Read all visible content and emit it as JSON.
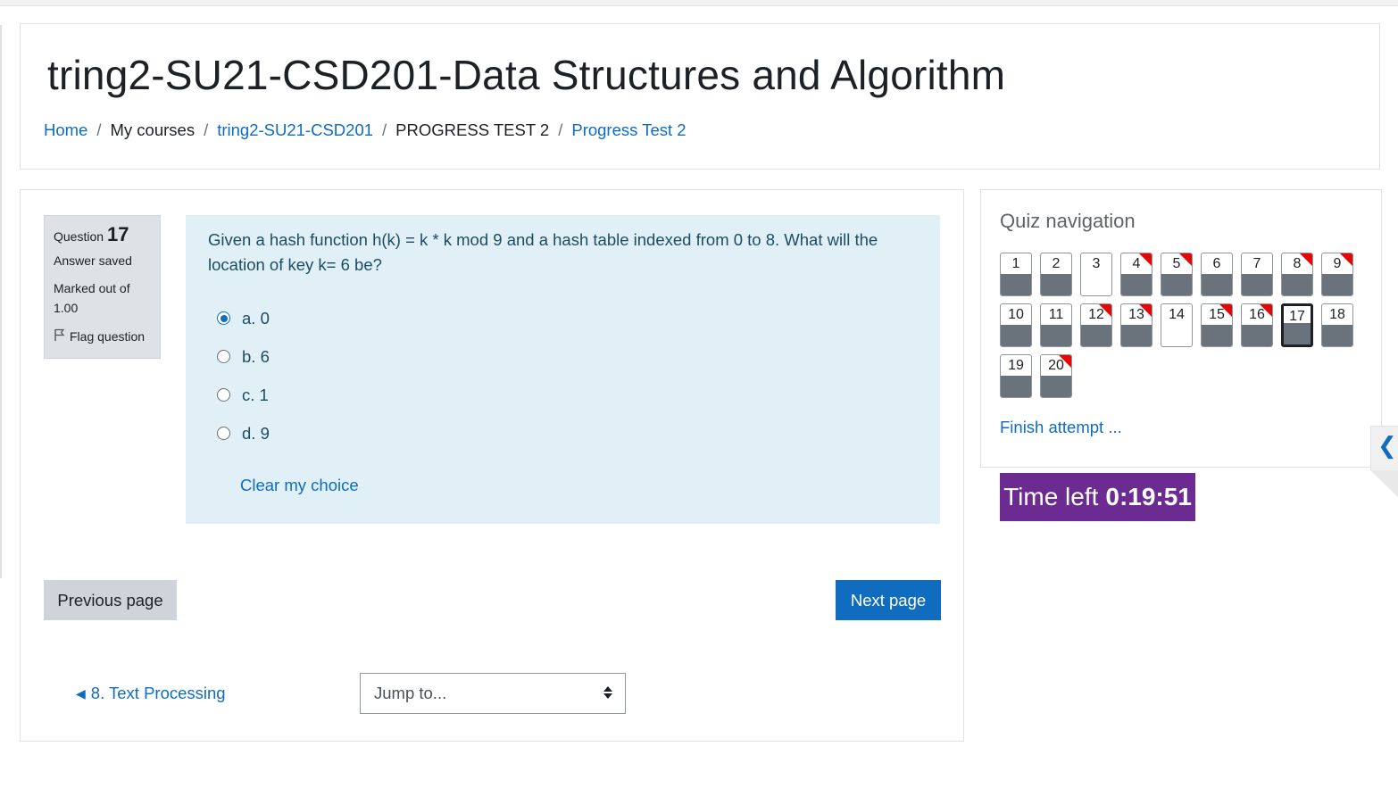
{
  "course_title": "tring2-SU21-CSD201-Data Structures and Algorithm",
  "breadcrumb": [
    {
      "label": "Home",
      "link": true
    },
    {
      "label": "My courses",
      "link": false
    },
    {
      "label": "tring2-SU21-CSD201",
      "link": true
    },
    {
      "label": "PROGRESS TEST 2",
      "link": false
    },
    {
      "label": "Progress Test 2",
      "link": true
    }
  ],
  "breadcrumb_separator": "/",
  "question_info": {
    "label": "Question",
    "number": "17",
    "state": "Answer saved",
    "grade": "Marked out of 1.00",
    "flag_label": "Flag question"
  },
  "question": {
    "text": "Given a hash function h(k) = k * k mod 9 and a hash table indexed from 0 to 8. What will the location of key k= 6 be?",
    "answers": [
      {
        "label": "a. 0",
        "selected": true
      },
      {
        "label": "b. 6",
        "selected": false
      },
      {
        "label": "c. 1",
        "selected": false
      },
      {
        "label": "d. 9",
        "selected": false
      }
    ],
    "clear_label": "Clear my choice"
  },
  "buttons": {
    "previous": "Previous page",
    "next": "Next page"
  },
  "activity_nav": {
    "prev_activity": "8. Text Processing",
    "jump_placeholder": "Jump to..."
  },
  "quiz_nav": {
    "title": "Quiz navigation",
    "questions": [
      {
        "n": "1",
        "answered": true,
        "flagged": false
      },
      {
        "n": "2",
        "answered": true,
        "flagged": false
      },
      {
        "n": "3",
        "answered": false,
        "flagged": false
      },
      {
        "n": "4",
        "answered": true,
        "flagged": true
      },
      {
        "n": "5",
        "answered": true,
        "flagged": true
      },
      {
        "n": "6",
        "answered": true,
        "flagged": false
      },
      {
        "n": "7",
        "answered": true,
        "flagged": false
      },
      {
        "n": "8",
        "answered": true,
        "flagged": true
      },
      {
        "n": "9",
        "answered": true,
        "flagged": true
      },
      {
        "n": "10",
        "answered": true,
        "flagged": false
      },
      {
        "n": "11",
        "answered": true,
        "flagged": false
      },
      {
        "n": "12",
        "answered": true,
        "flagged": true
      },
      {
        "n": "13",
        "answered": true,
        "flagged": true
      },
      {
        "n": "14",
        "answered": false,
        "flagged": false
      },
      {
        "n": "15",
        "answered": true,
        "flagged": true
      },
      {
        "n": "16",
        "answered": true,
        "flagged": true
      },
      {
        "n": "17",
        "answered": true,
        "flagged": false,
        "current": true
      },
      {
        "n": "18",
        "answered": true,
        "flagged": false
      },
      {
        "n": "19",
        "answered": true,
        "flagged": false
      },
      {
        "n": "20",
        "answered": true,
        "flagged": true
      }
    ],
    "finish_label": "Finish attempt ..."
  },
  "timer": {
    "label": "Time left",
    "value": "0:19:51"
  },
  "colors": {
    "link": "#0f6cbf",
    "timer_bg": "#6b2b91",
    "question_bg": "#e0f0f6",
    "flag": "#e30808"
  },
  "icons": {
    "flag": "flag-icon",
    "drawer_toggle": "chevron-left-icon",
    "select_caret": "sort-caret-icon",
    "prev_activity": "arrow-left-icon"
  }
}
